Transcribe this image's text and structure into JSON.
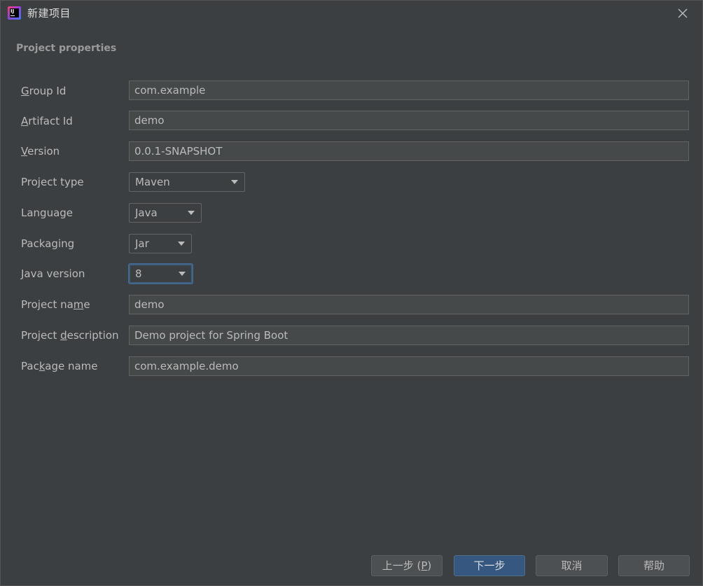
{
  "window": {
    "title": "新建项目",
    "app_icon": "intellij-idea-icon",
    "close_icon": "close-icon"
  },
  "section": {
    "title": "Project properties"
  },
  "form": {
    "group_id": {
      "label": "Group Id",
      "mnemonic": "G",
      "rest": "roup Id",
      "value": "com.example"
    },
    "artifact_id": {
      "label": "Artifact Id",
      "mnemonic": "A",
      "rest": "rtifact Id",
      "value": "demo"
    },
    "version": {
      "label": "Version",
      "mnemonic": "V",
      "rest": "ersion",
      "value": "0.0.1-SNAPSHOT"
    },
    "project_type": {
      "label": "Project type",
      "value": "Maven"
    },
    "language": {
      "label": "Language",
      "value": "Java"
    },
    "packaging": {
      "label": "Packaging",
      "value": "Jar"
    },
    "java_version": {
      "label": "Java version",
      "value": "8"
    },
    "project_name": {
      "label": "Project name",
      "pre": "Project na",
      "mnemonic": "m",
      "rest": "e",
      "value": "demo"
    },
    "project_description": {
      "label": "Project description",
      "pre": "Project ",
      "mnemonic": "d",
      "rest": "escription",
      "value": "Demo project for Spring Boot"
    },
    "package_name": {
      "label": "Package name",
      "pre": "Pac",
      "mnemonic": "k",
      "rest": "age name",
      "value": "com.example.demo"
    }
  },
  "buttons": {
    "previous": {
      "pre": "上一步 (",
      "mnemonic": "P",
      "post": ")"
    },
    "next": "下一步",
    "cancel": "取消",
    "help": "帮助"
  },
  "colors": {
    "background": "#3c3f41",
    "field_background": "#45494a",
    "default_button": "#365880",
    "focus_border": "#3d6185"
  }
}
